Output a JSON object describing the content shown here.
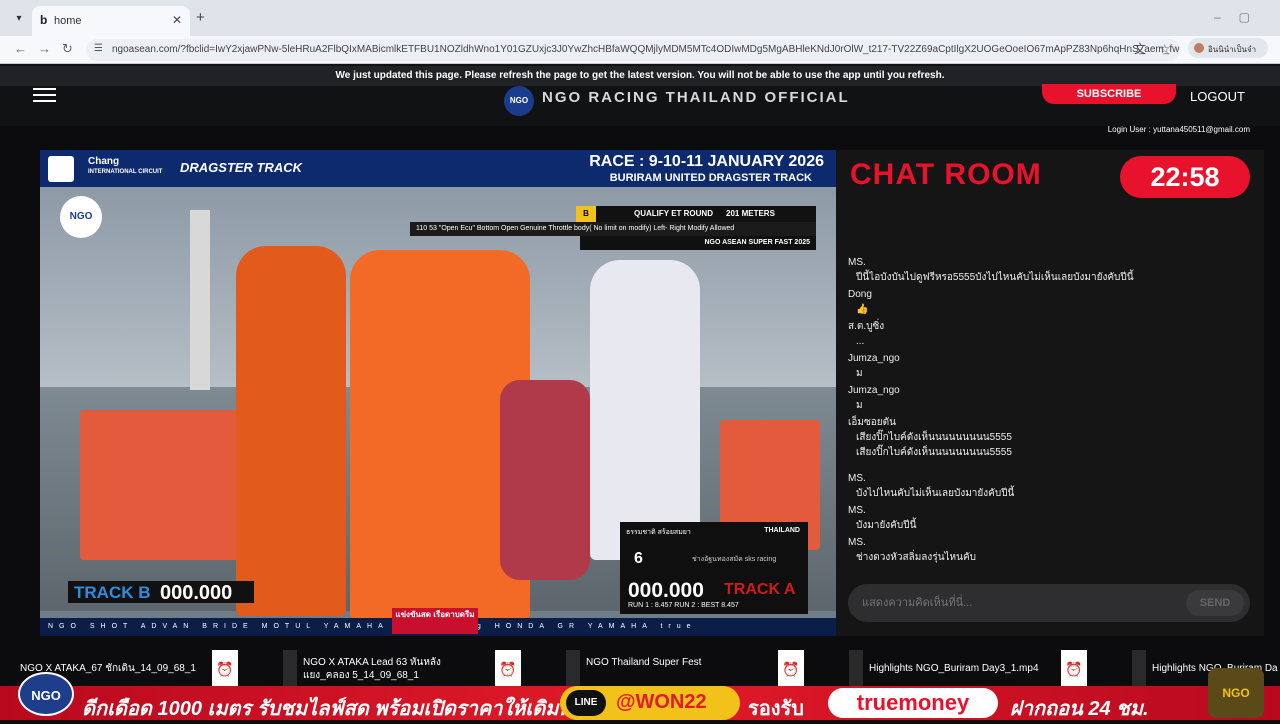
{
  "browser": {
    "tab_title": "home",
    "favicon": "b",
    "url": "ngoasean.com/?fbclid=IwY2xjawPNw-5leHRuA2FlbQIxMABicmlkETFBU1NOZldhWno1Y01GZUxjc3J0YwZhcHBfaWQQMjlyMDM5MTc4ODIwMDg5MgABHleKNdJ0rOlW_t217-TV22Z69aCptIlgX2UOGeOoeIO67mApPZ83Np6hqHnS_aem_fwE7TlcNC...",
    "translate_label": "อินนินำเป็นจำ",
    "icons": {
      "back": "back-arrow-icon",
      "forward": "forward-arrow-icon",
      "reload": "reload-icon",
      "site_info": "site-info-icon",
      "translate": "translate-icon",
      "star": "bookmark-star-icon"
    }
  },
  "site": {
    "notice": "We just updated this page. Please refresh the page to get the latest version. You will not be able to use the app until you refresh.",
    "title": "NGO RACING THAILAND OFFICIAL",
    "logo_text": "NGO",
    "subscribe_label": "SUBSCRIBE",
    "logout_label": "LOGOUT",
    "login_user": "Login User : yuttana450511@gmail.com"
  },
  "video": {
    "header_left_1": "Chang",
    "header_left_2": "INTERNATIONAL CIRCUIT",
    "header_left_3": "DRAGSTER TRACK",
    "race_title": "RACE : 9-10-11 JANUARY 2026",
    "race_subtitle": "BURIRAM UNITED DRAGSTER TRACK",
    "corner_logo": "NGO",
    "qual_letter": "B",
    "qual_round": "QUALIFY ET ROUND",
    "distance": "201 METERS",
    "class_text": "110 53 \"Open Ecu\" Bottom Open Genuine Throttle body( No limit on modify) Left- Right Modify Allowed",
    "event_text": "NGO ASEAN SUPER FAST 2025",
    "track_b_label": "TRACK B",
    "track_b_time": "000.000",
    "rider_name": "ธรรมชาติ สร้อยสมยา",
    "country": "THAILAND",
    "lane": "6",
    "team": "ช่างอัฐนทองสมัค sks racing",
    "track_a_time": "000.000",
    "track_a_label": "TRACK A",
    "run_info": "RUN 1 : 8.457   RUN 2 :          BEST   8.457",
    "promo_tag": "แข่งขันสด เรือดาบดรีม",
    "sponsors": "NGO SHOT ADVAN BRIDE MOTUL YAMAHA SKY Chang HONDA GR YAMAHA true"
  },
  "chat": {
    "title": "CHAT ROOM",
    "timer": "22:58",
    "messages": [
      {
        "user": "MS.",
        "text": "ปีนี้ไอบังบันไปดูฟรีหรอ5555บังไปไหนคับไม่เห็นเลยบังมายังคับปีนี้"
      },
      {
        "user": "Dong",
        "text": "👍"
      },
      {
        "user": "ส.ต.บูซิ่ง",
        "text": "..."
      },
      {
        "user": "Jumza_ngo",
        "text": "ม"
      },
      {
        "user": "Jumza_ngo",
        "text": "ม"
      },
      {
        "user": "เอ็มซอยตัน",
        "text": "เสียงปิ๊กไบค์ดังเห็นนนนนนนนน5555"
      },
      {
        "user": "",
        "text": "เสียงปิ๊กไบค์ดังเห็นนนนนนนนน5555"
      },
      {
        "user": "MS.",
        "text": "บังไปไหนคับไม่เห็นเลยบังมายังคับปีนี้"
      },
      {
        "user": "MS.",
        "text": "บังมายังคับปีนี้"
      },
      {
        "user": "MS.",
        "text": "ช่างดวงหัวสลิ่มลงรุ่นไหนคับ"
      }
    ],
    "input_placeholder": "แสดงความคิดเห็นที่นี่...",
    "send_label": "SEND"
  },
  "playlist": [
    {
      "title": "NGO X ATAKA_67 ชักเดิน_14_09_68_1"
    },
    {
      "title": "NGO X ATAKA Lead 63 หันหลัง แยง_คลอง 5_14_09_68_1"
    },
    {
      "title": "NGO Thailand Super Fest"
    },
    {
      "title": "Highlights NGO_Buriram Day3_1.mp4"
    },
    {
      "title": "Highlights NGO_Buriram Da"
    }
  ],
  "banner": {
    "text1": "ดีกเดือด 1000 เมตร รับชมไลฟ์สด พร้อมเปิดราคาให้เดิมพัน",
    "line_label": "LINE",
    "line_id": "@WON22",
    "text2": "รองรับ",
    "wallet": "truemoney",
    "text3": "ฝากถอน 24 ชม.",
    "logo": "NGO"
  }
}
